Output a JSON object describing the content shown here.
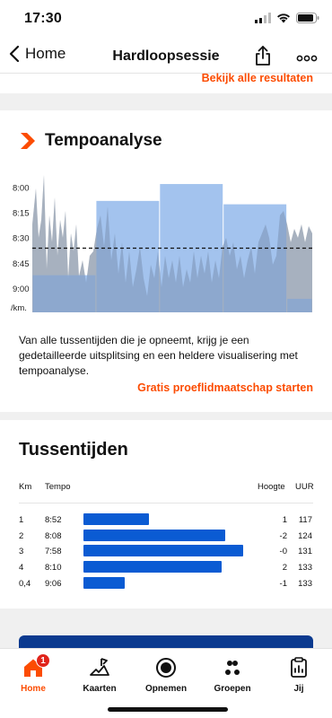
{
  "status": {
    "time": "17:30"
  },
  "nav": {
    "back_label": "Home",
    "title": "Hardloopsessie"
  },
  "top_link": "Bekijk alle resultaten",
  "tempo": {
    "title": "Tempoanalyse",
    "description": "Van alle tussentijden die je opneemt, krijg je een gedetailleerde uitsplitsing en een heldere visualisering met tempoanalyse.",
    "cta": "Gratis proeflidmaatschap starten"
  },
  "chart_data": {
    "type": "bar",
    "y_ticks": [
      "8:00",
      "8:15",
      "8:30",
      "8:45",
      "9:00"
    ],
    "y_unit": "/km.",
    "y_range_seconds_per_km": [
      470,
      554
    ],
    "average_pace_seconds": 516,
    "splits_seconds": [
      532,
      488,
      478,
      490,
      546
    ],
    "split_distance_km": [
      1,
      1,
      1,
      1,
      0.4
    ],
    "colors": {
      "bars": "#8fb6ea",
      "trace": "#c9c9c9",
      "trace_overlap": "#7f95b3",
      "average": "#111111"
    }
  },
  "splits": {
    "title": "Tussentijden",
    "headers": {
      "km": "Km",
      "tempo": "Tempo",
      "hoogte": "Hoogte",
      "uur": "UUR"
    },
    "rows": [
      {
        "km": "1",
        "tempo": "8:52",
        "hoogte": "1",
        "uur": "117",
        "fraction": 0.37
      },
      {
        "km": "2",
        "tempo": "8:08",
        "hoogte": "-2",
        "uur": "124",
        "fraction": 0.8
      },
      {
        "km": "3",
        "tempo": "7:58",
        "hoogte": "-0",
        "uur": "131",
        "fraction": 0.9
      },
      {
        "km": "4",
        "tempo": "8:10",
        "hoogte": "2",
        "uur": "133",
        "fraction": 0.78
      },
      {
        "km": "0,4",
        "tempo": "9:06",
        "hoogte": "-1",
        "uur": "133",
        "fraction": 0.23
      }
    ],
    "bar_color": "#0a5bd3"
  },
  "tabs": [
    {
      "label": "Home",
      "icon": "home-icon",
      "badge": "1"
    },
    {
      "label": "Kaarten",
      "icon": "map-icon"
    },
    {
      "label": "Opnemen",
      "icon": "record-icon"
    },
    {
      "label": "Groepen",
      "icon": "groups-icon"
    },
    {
      "label": "Jij",
      "icon": "profile-icon"
    }
  ],
  "accent": "#fc4c02"
}
